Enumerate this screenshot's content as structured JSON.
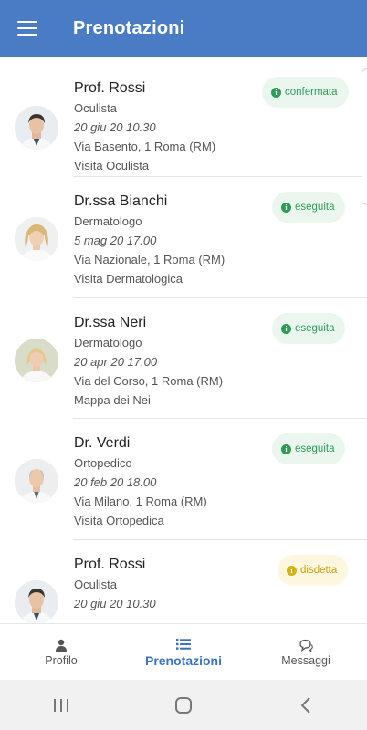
{
  "header": {
    "title": "Prenotazioni",
    "menu_icon": "hamburger-menu-icon"
  },
  "bookings": [
    {
      "name": "Prof. Rossi",
      "specialty": "Oculista",
      "datetime": "20 giu 20 10.30",
      "address": "Via Basento, 1 Roma (RM)",
      "visit": "Visita Oculista",
      "status": "confermata",
      "status_color": "#2e9b57"
    },
    {
      "name": "Dr.ssa Bianchi",
      "specialty": "Dermatologo",
      "datetime": "5 mag 20 17.00",
      "address": "Via Nazionale, 1 Roma (RM)",
      "visit": "Visita Dermatologica",
      "status": "eseguita",
      "status_color": "#2e9b57"
    },
    {
      "name": "Dr.ssa Neri",
      "specialty": "Dermatologo",
      "datetime": "20 apr 20 17.00",
      "address": "Via del Corso, 1 Roma (RM)",
      "visit": "Mappa dei Nei",
      "status": "eseguita",
      "status_color": "#2e9b57"
    },
    {
      "name": "Dr. Verdi",
      "specialty": "Ortopedico",
      "datetime": "20 feb 20 18.00",
      "address": "Via Milano, 1 Roma (RM)",
      "visit": "Visita Ortopedica",
      "status": "eseguita",
      "status_color": "#2e9b57"
    },
    {
      "name": "Prof. Rossi",
      "specialty": "Oculista",
      "datetime": "20 giu 20 10.30",
      "address": "",
      "visit": "",
      "status": "disdetta",
      "status_color": "#c7a10a"
    }
  ],
  "bottom_nav": {
    "profile": {
      "label": "Profilo",
      "icon": "user-icon"
    },
    "bookings": {
      "label": "Prenotazioni",
      "icon": "list-icon"
    },
    "messages": {
      "label": "Messaggi",
      "icon": "chat-icon"
    },
    "active_color": "#3b73c0"
  },
  "colors": {
    "primary": "#4a7cc5"
  }
}
